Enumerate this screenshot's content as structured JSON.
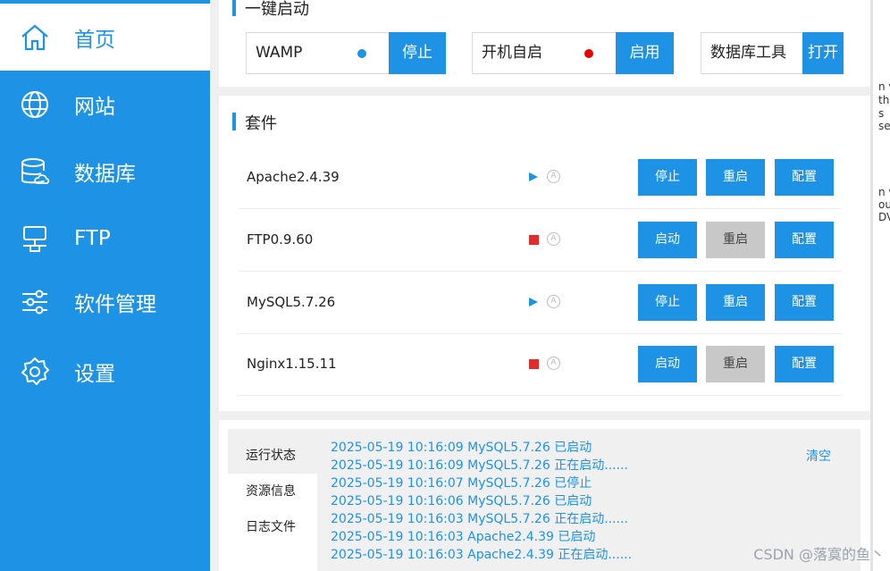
{
  "sidebar": {
    "items": [
      {
        "label": "首页",
        "icon": "home-icon"
      },
      {
        "label": "网站",
        "icon": "globe-icon"
      },
      {
        "label": "数据库",
        "icon": "database-icon"
      },
      {
        "label": "FTP",
        "icon": "server-icon"
      },
      {
        "label": "软件管理",
        "icon": "sliders-icon"
      },
      {
        "label": "设置",
        "icon": "gear-icon"
      }
    ]
  },
  "quick_start": {
    "title": "一键启动",
    "items": [
      {
        "label": "WAMP",
        "status_color": "#1e93e6",
        "button": "停止"
      },
      {
        "label": "开机自启",
        "status_color": "#e60000",
        "button": "启用"
      },
      {
        "label": "数据库工具",
        "button": "打开"
      }
    ]
  },
  "suites": {
    "title": "套件",
    "rows": [
      {
        "name": "Apache2.4.39",
        "status": "running",
        "auto_badge": "A",
        "buttons": [
          "停止",
          "重启",
          "配置"
        ]
      },
      {
        "name": "FTP0.9.60",
        "status": "stopped",
        "auto_badge": "A",
        "buttons": [
          "启动",
          "重启",
          "配置"
        ]
      },
      {
        "name": "MySQL5.7.26",
        "status": "running",
        "auto_badge": "A",
        "buttons": [
          "停止",
          "重启",
          "配置"
        ]
      },
      {
        "name": "Nginx1.15.11",
        "status": "stopped",
        "auto_badge": "A",
        "buttons": [
          "启动",
          "重启",
          "配置"
        ]
      }
    ]
  },
  "status_panel": {
    "tabs": [
      "运行状态",
      "资源信息",
      "日志文件"
    ],
    "clear_label": "清空",
    "logs": [
      "2025-05-19 10:16:09 MySQL5.7.26 已启动",
      "2025-05-19 10:16:09 MySQL5.7.26 正在启动......",
      "2025-05-19 10:16:07 MySQL5.7.26 已停止",
      "2025-05-19 10:16:06 MySQL5.7.26 已启动",
      "2025-05-19 10:16:03 MySQL5.7.26 正在启动......",
      "2025-05-19 10:16:03 Apache2.4.39 已启动",
      "2025-05-19 10:16:03 Apache2.4.39 正在启动......"
    ]
  },
  "right_strip": {
    "fragments": [
      "n v",
      "th",
      "s",
      "se",
      "n v",
      "ou",
      "DV"
    ]
  },
  "watermark": "CSDN @落寞的鱼丶",
  "colors": {
    "accent": "#1e93e6",
    "stopped": "#e02c2c",
    "disabled": "#c8c8c8"
  }
}
